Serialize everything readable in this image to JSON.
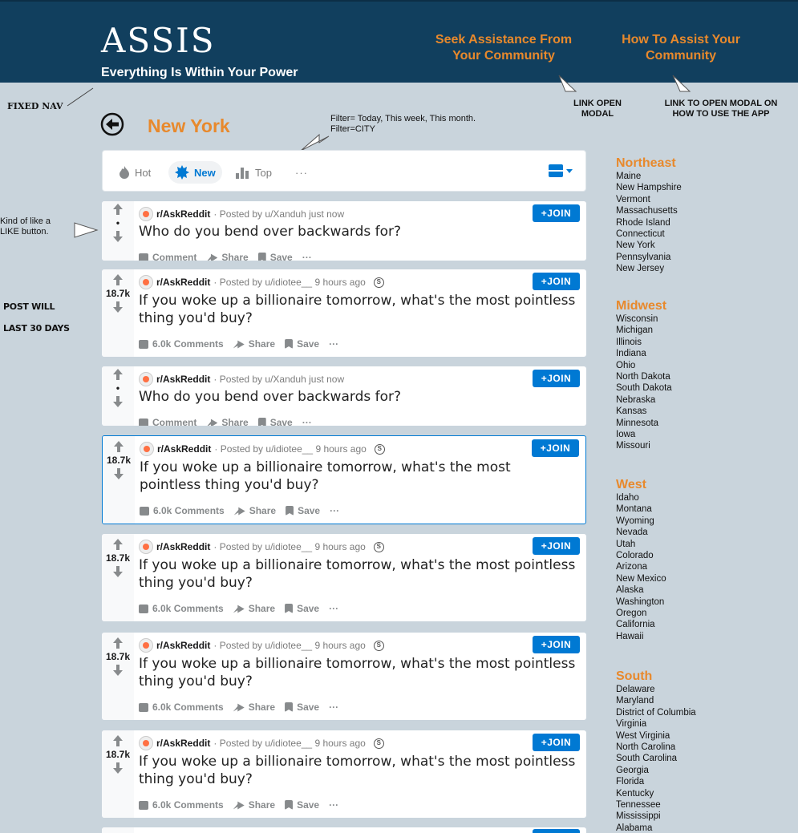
{
  "header": {
    "brand": "ASSIS",
    "tagline": "Everything Is Within Your Power",
    "seek_link": "Seek Assistance From Your Community",
    "how_link": "How To Assist Your Community"
  },
  "annotations": {
    "fixed_nav": "FIXED NAV",
    "link_open_modal": "LINK OPEN MODAL",
    "link_how_modal": "LINK TO OPEN MODAL ON HOW TO USE THE APP",
    "filter_note": "Filter= Today, This week, This month. Filter=CITY",
    "like_note": "Kind of like a LIKE button.",
    "post_will": "POST WILL",
    "last_30": "LAST 30 DAYS"
  },
  "page": {
    "city": "New York"
  },
  "sortbar": {
    "hot": "Hot",
    "new": "New",
    "top": "Top",
    "more": "···"
  },
  "posts": [
    {
      "sub": "r/AskReddit",
      "byline": "· Posted by u/Xanduh just now",
      "score": "•",
      "title": "Who do you bend over backwards for?",
      "comments": "Comment",
      "share": "Share",
      "save": "Save",
      "more": "···",
      "join": "+JOIN"
    },
    {
      "sub": "r/AskReddit",
      "byline": "· Posted by u/idiotee__ 9 hours ago",
      "score": "18.7k",
      "title": "If you woke up a billionaire tomorrow, what's the most pointless thing you'd buy?",
      "comments": "6.0k Comments",
      "share": "Share",
      "save": "Save",
      "more": "···",
      "join": "+JOIN"
    },
    {
      "sub": "r/AskReddit",
      "byline": "· Posted by u/Xanduh just now",
      "score": "•",
      "title": "Who do you bend over backwards for?",
      "comments": "Comment",
      "share": "Share",
      "save": "Save",
      "more": "···",
      "join": "+JOIN"
    },
    {
      "sub": "r/AskReddit",
      "byline": "· Posted by u/idiotee__ 9 hours ago",
      "score": "18.7k",
      "title": "If you woke up a billionaire tomorrow, what's the most pointless thing you'd buy?",
      "comments": "6.0k Comments",
      "share": "Share",
      "save": "Save",
      "more": "···",
      "join": "+JOIN"
    },
    {
      "sub": "r/AskReddit",
      "byline": "· Posted by u/idiotee__ 9 hours ago",
      "score": "18.7k",
      "title": "If you woke up a billionaire tomorrow, what's the most pointless thing you'd buy?",
      "comments": "6.0k Comments",
      "share": "Share",
      "save": "Save",
      "more": "···",
      "join": "+JOIN"
    },
    {
      "sub": "r/AskReddit",
      "byline": "· Posted by u/idiotee__ 9 hours ago",
      "score": "18.7k",
      "title": "If you woke up a billionaire tomorrow, what's the most pointless thing you'd buy?",
      "comments": "6.0k Comments",
      "share": "Share",
      "save": "Save",
      "more": "···",
      "join": "+JOIN"
    },
    {
      "sub": "r/AskReddit",
      "byline": "· Posted by u/idiotee__ 9 hours ago",
      "score": "18.7k",
      "title": "If you woke up a billionaire tomorrow, what's the most pointless thing you'd buy?",
      "comments": "6.0k Comments",
      "share": "Share",
      "save": "Save",
      "more": "···",
      "join": "+JOIN"
    }
  ],
  "regions": {
    "northeast": {
      "name": "Northeast",
      "states": [
        "Maine",
        "New Hampshire",
        "Vermont",
        "Massachusetts",
        "Rhode Island",
        "Connecticut",
        "New York",
        "Pennsylvania",
        "New Jersey"
      ]
    },
    "midwest": {
      "name": "Midwest",
      "states": [
        "Wisconsin",
        "Michigan",
        "Illinois",
        "Indiana",
        "Ohio",
        "North Dakota",
        "South Dakota",
        "Nebraska",
        "Kansas",
        "Minnesota",
        "Iowa",
        "Missouri"
      ]
    },
    "west": {
      "name": "West",
      "states": [
        "Idaho",
        "Montana",
        "Wyoming",
        "Nevada",
        "Utah",
        "Colorado",
        "Arizona",
        "New Mexico",
        "Alaska",
        "Washington",
        "Oregon",
        "California",
        "Hawaii"
      ]
    },
    "south": {
      "name": "South",
      "states": [
        "Delaware",
        "Maryland",
        "District of Columbia",
        "Virginia",
        "West Virginia",
        "North Carolina",
        "South Carolina",
        "Georgia",
        "Florida",
        "Kentucky",
        "Tennessee",
        "Mississippi",
        "Alabama"
      ]
    }
  },
  "colors": {
    "header_bg": "#113f5e",
    "accent_orange": "#e8892c",
    "page_bg": "#c9d4dc",
    "link_blue": "#0079d3"
  }
}
